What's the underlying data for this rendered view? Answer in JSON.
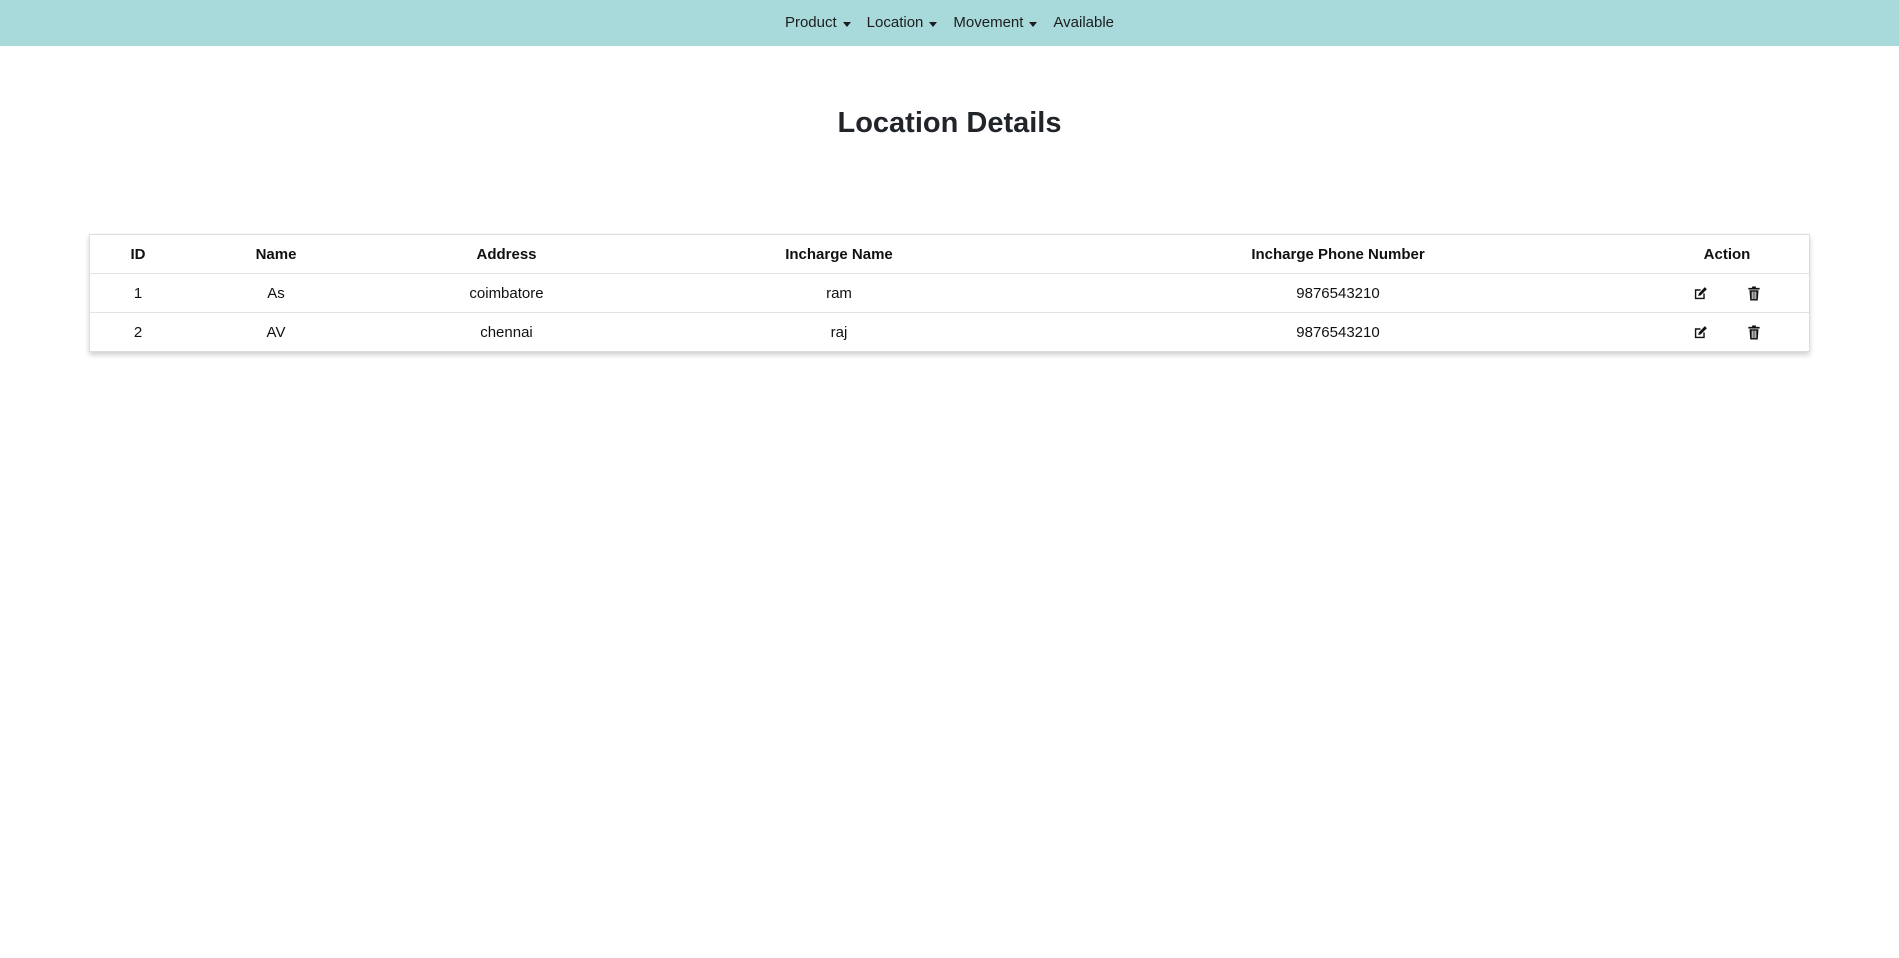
{
  "navbar": {
    "items": [
      {
        "label": "Product",
        "dropdown": true
      },
      {
        "label": "Location",
        "dropdown": true
      },
      {
        "label": "Movement",
        "dropdown": true
      },
      {
        "label": "Available",
        "dropdown": false
      }
    ]
  },
  "page": {
    "title": "Location Details"
  },
  "table": {
    "headers": [
      "ID",
      "Name",
      "Address",
      "Incharge Name",
      "Incharge Phone Number",
      "Action"
    ],
    "rows": [
      {
        "id": "1",
        "name": "As",
        "address": "coimbatore",
        "incharge_name": "ram",
        "phone": "9876543210"
      },
      {
        "id": "2",
        "name": "AV",
        "address": "chennai",
        "incharge_name": "raj",
        "phone": "9876543210"
      }
    ],
    "actions": {
      "edit_icon": "edit-icon",
      "delete_icon": "trash-icon"
    }
  },
  "colors": {
    "navbar_bg": "#a8dadc",
    "text": "#212529"
  }
}
